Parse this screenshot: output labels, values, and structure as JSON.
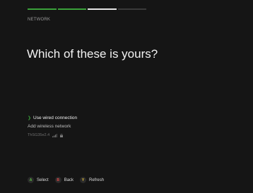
{
  "progress": {
    "steps_total": 4,
    "steps_done": 2,
    "current_step": 3
  },
  "section_label": "NETWORK",
  "heading": "Which of these is yours?",
  "options": [
    {
      "label": "Use wired connection",
      "selected": true
    },
    {
      "label": "Add wireless network",
      "selected": false
    }
  ],
  "networks": [
    {
      "ssid": "ThSG35e2.4",
      "signal_icon": "wifi-signal-icon",
      "secured_icon": "lock-icon"
    }
  ],
  "footer": {
    "select": {
      "button": "A",
      "label": "Select"
    },
    "back": {
      "button": "B",
      "label": "Back"
    },
    "refresh": {
      "button": "Y",
      "label": "Refresh"
    }
  },
  "colors": {
    "background": "#151515",
    "accent_green": "#3aa23a",
    "button_a": "#5bbd42",
    "button_b": "#e04a4a",
    "button_y": "#e8c23a"
  }
}
